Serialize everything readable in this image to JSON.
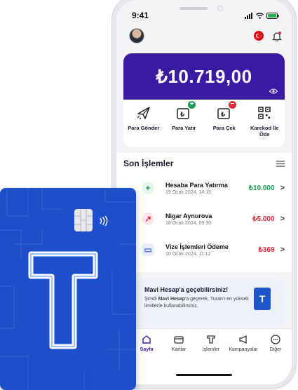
{
  "status_bar": {
    "time": "9:41"
  },
  "account": {
    "balance": "₺10.719,00"
  },
  "quick_actions": [
    {
      "label": "Para Gönder",
      "icon": "send-icon"
    },
    {
      "label": "Para Yatır",
      "icon": "deposit-icon"
    },
    {
      "label": "Para Çek",
      "icon": "withdraw-icon"
    },
    {
      "label": "Karekod İle Öde",
      "icon": "qr-code-icon"
    }
  ],
  "transactions": {
    "title": "Son İşlemler",
    "items": [
      {
        "name": "Hesaba Para Yatırma",
        "date": "19 Ocak 2024, 14:15",
        "amount": "₺10.000",
        "amount_color": "#1f9d55",
        "icon": "plus-icon",
        "icon_color": "#1f9d55",
        "icon_bg": "#e4f5ea"
      },
      {
        "name": "Nigar Aynurova",
        "date": "18 Ocak 2024, 09:30",
        "amount": "₺5.000",
        "amount_color": "#e02b3b",
        "icon": "arrow-up-right-icon",
        "icon_color": "#e02b3b",
        "icon_bg": "#fde6e8"
      },
      {
        "name": "Vize İşlemleri Ödeme",
        "date": "10 Ocak 2024, 11:12",
        "amount": "₺369",
        "amount_color": "#e02b3b",
        "icon": "card-icon",
        "icon_color": "#3b6fe0",
        "icon_bg": "#e6edfc"
      }
    ]
  },
  "promo": {
    "title": "Mavi Hesap'a geçebilirsiniz!",
    "text_bold": "Mavi Hesap",
    "text": "a geçerek, Turan'ın en yüksek limitlerle kullanabilirsiniz.",
    "text_prefix": "Şimdi ",
    "text_suffix": "'a geçerek, Turan'ı",
    "text_line2": "en yüksek limitlerle kullanabilirsiniz."
  },
  "tabbar": {
    "items": [
      {
        "label": "Sayfa",
        "icon": "home-icon",
        "active": true
      },
      {
        "label": "Kartlar",
        "icon": "cards-icon",
        "active": false
      },
      {
        "label": "İşlemler",
        "icon": "transactions-icon",
        "active": false
      },
      {
        "label": "Kampanyalar",
        "icon": "megaphone-icon",
        "active": false
      },
      {
        "label": "Diğer",
        "icon": "more-icon",
        "active": false
      }
    ]
  },
  "colors": {
    "brand_purple": "#3b1aa3",
    "card_blue": "#1e4fcb",
    "positive": "#1f9d55",
    "negative": "#e02b3b"
  }
}
